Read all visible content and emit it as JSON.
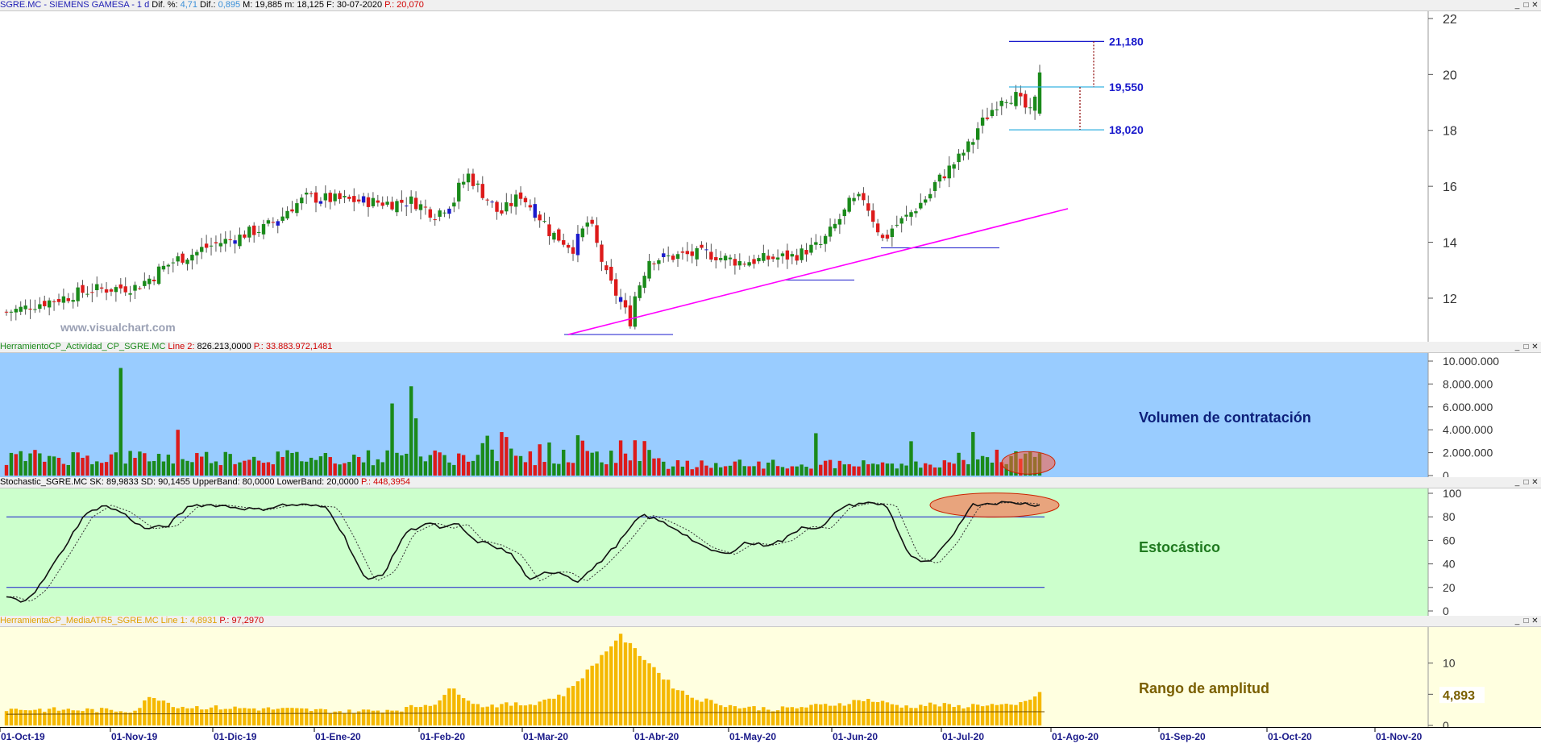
{
  "price_panel": {
    "header": [
      {
        "text": "SGRE.MC - SIEMENS GAMESA -  1 d",
        "color": "#1d1db4"
      },
      {
        "text": "Dif. %:",
        "color": "#000000"
      },
      {
        "text": "4,71",
        "color": "#3a8fd8"
      },
      {
        "text": "Dif.:",
        "color": "#000000"
      },
      {
        "text": "0,895",
        "color": "#3a8fd8"
      },
      {
        "text": "M: 19,885",
        "color": "#000000"
      },
      {
        "text": "m: 18,125",
        "color": "#000000"
      },
      {
        "text": "F: 30-07-2020",
        "color": "#000000"
      },
      {
        "text": "P.: 20,070",
        "color": "#d00000"
      }
    ],
    "watermark": "www.visualchart.com",
    "levels": [
      {
        "label": "21,180",
        "value": 21.18
      },
      {
        "label": "19,550",
        "value": 19.55
      },
      {
        "label": "18,020",
        "value": 18.02
      }
    ],
    "y_ticks": [
      "22",
      "20",
      "18",
      "16",
      "14",
      "12"
    ]
  },
  "volume_panel": {
    "header": [
      {
        "text": "HerramientoCP_Actividad_CP_SGRE.MC",
        "color": "#1a8a1a"
      },
      {
        "text": "Line 2:",
        "color": "#d00000"
      },
      {
        "text": "826.213,0000",
        "color": "#000000"
      },
      {
        "text": "P.: 33.883.972,1481",
        "color": "#d00000"
      }
    ],
    "title": "Volumen de contratación",
    "y_ticks": [
      "10.000.000",
      "8.000.000",
      "6.000.000",
      "4.000.000",
      "2.000.000",
      "0"
    ]
  },
  "stoch_panel": {
    "header": [
      {
        "text": "Stochastic_SGRE.MC",
        "color": "#000000"
      },
      {
        "text": "SK: 89,9833",
        "color": "#000000"
      },
      {
        "text": "SD: 90,1455",
        "color": "#000000"
      },
      {
        "text": "UpperBand: 80,0000",
        "color": "#000000"
      },
      {
        "text": "LowerBand: 20,0000",
        "color": "#000000"
      },
      {
        "text": "P.: 448,3954",
        "color": "#d00000"
      }
    ],
    "title": "Estocástico",
    "y_ticks": [
      "100",
      "80",
      "60",
      "40",
      "20",
      "0"
    ]
  },
  "atr_panel": {
    "header": [
      {
        "text": "HerramientaCP_MediaATR5_SGRE.MC",
        "color": "#e0a000"
      },
      {
        "text": "Line 1: 4,8931",
        "color": "#e0a000"
      },
      {
        "text": "P.: 97,2970",
        "color": "#d00000"
      }
    ],
    "title": "Rango de amplitud",
    "y_ticks": [
      "10",
      "5",
      "0"
    ],
    "last_value": "4,893"
  },
  "x_axis": {
    "labels": [
      "01-Oct-19",
      "01-Nov-19",
      "01-Dic-19",
      "01-Ene-20",
      "01-Feb-20",
      "01-Mar-20",
      "01-Abr-20",
      "01-May-20",
      "01-Jun-20",
      "01-Jul-20",
      "01-Ago-20",
      "01-Sep-20",
      "01-Oct-20",
      "01-Nov-20"
    ],
    "year_label": "2020"
  },
  "chart_data": [
    {
      "type": "candlestick",
      "title": "SGRE.MC - SIEMENS GAMESA - 1 d",
      "ylim": [
        10.5,
        22.2
      ],
      "x_range": [
        "01-Oct-19",
        "01-Nov-20"
      ],
      "last": {
        "date": "30-07-2020",
        "high": 19.885,
        "low": 18.125,
        "close": 20.07,
        "change_pct": 4.71,
        "change": 0.895
      },
      "monthly_closes": [
        {
          "x": "01-Oct-19",
          "y": 11.5
        },
        {
          "x": "01-Nov-19",
          "y": 12.4
        },
        {
          "x": "01-Dic-19",
          "y": 14.5
        },
        {
          "x": "01-Ene-20",
          "y": 15.6
        },
        {
          "x": "01-Feb-20",
          "y": 15.1
        },
        {
          "x": "01-Mar-20",
          "y": 13.5
        },
        {
          "x": "01-Abr-20",
          "y": 13.6
        },
        {
          "x": "01-May-20",
          "y": 13.5
        },
        {
          "x": "01-Jun-20",
          "y": 15.4
        },
        {
          "x": "01-Jul-20",
          "y": 18.6
        },
        {
          "x": "30-07-2020",
          "y": 20.07
        }
      ],
      "support_lines": [
        {
          "y": 10.7
        },
        {
          "y": 12.65
        },
        {
          "y": 13.8
        }
      ],
      "trendline": {
        "from": {
          "x": "16-Mar-20",
          "y": 10.7
        },
        "to": {
          "x": "30-Jul-20",
          "y": 15.2
        }
      },
      "levels": [
        21.18,
        19.55,
        18.02
      ]
    },
    {
      "type": "bar",
      "title": "Volumen de contratación",
      "ylim": [
        0,
        10000000
      ],
      "notable_peaks": [
        {
          "x": "Nov-19",
          "y": 9400000
        },
        {
          "x": "Feb-20",
          "y": 7800000
        },
        {
          "x": "Feb-20",
          "y": 6300000
        }
      ],
      "last_line_value": 826213
    },
    {
      "type": "line",
      "title": "Estocástico",
      "ylim": [
        0,
        100
      ],
      "bands": [
        80,
        20
      ],
      "series": [
        {
          "name": "SK",
          "last": 89.9833
        },
        {
          "name": "SD",
          "last": 90.1455
        }
      ],
      "x": [
        "01-Oct-19",
        "01-Nov-19",
        "01-Dic-19",
        "01-Ene-20",
        "01-Feb-20",
        "01-Mar-20",
        "01-Abr-20",
        "01-May-20",
        "01-Jun-20",
        "01-Jul-20"
      ],
      "values": [
        12,
        75,
        90,
        88,
        70,
        22,
        80,
        58,
        92,
        92
      ]
    },
    {
      "type": "bar",
      "title": "Rango de amplitud",
      "ylim": [
        0,
        15
      ],
      "series": [
        {
          "name": "Line 1",
          "last": 4.8931
        }
      ],
      "peak": {
        "x": "Mar-20",
        "y": 14.5
      }
    }
  ]
}
